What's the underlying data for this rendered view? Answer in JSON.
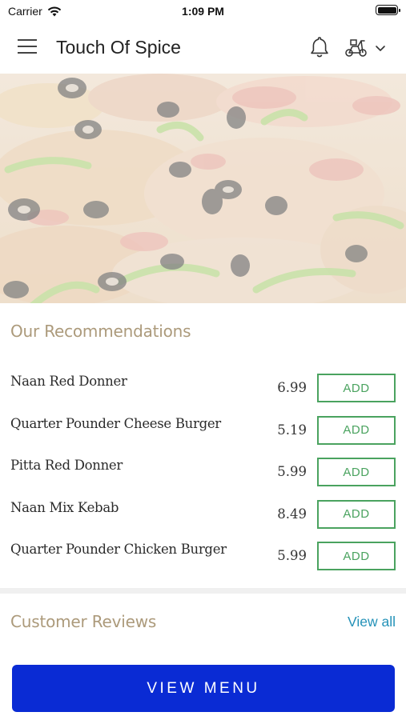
{
  "status_bar": {
    "carrier": "Carrier",
    "time": "1:09 PM"
  },
  "header": {
    "title": "Touch Of Spice",
    "menu_icon": "hamburger-menu-icon",
    "notification_icon": "bell-icon",
    "delivery_icon": "scooter-icon",
    "dropdown_icon": "chevron-down-icon"
  },
  "hero": {
    "image": "pizza-photo"
  },
  "recommendations": {
    "title": "Our Recommendations",
    "add_label": "ADD",
    "items": [
      {
        "name": "Naan Red Donner",
        "price": "6.99"
      },
      {
        "name": "Quarter Pounder Cheese Burger",
        "price": "5.19"
      },
      {
        "name": "Pitta Red Donner",
        "price": "5.99"
      },
      {
        "name": "Naan Mix Kebab",
        "price": "8.49"
      },
      {
        "name": "Quarter Pounder Chicken Burger",
        "price": "5.99"
      }
    ]
  },
  "reviews": {
    "title": "Customer Reviews",
    "view_all": "View all"
  },
  "cta": {
    "label": "VIEW MENU"
  },
  "colors": {
    "accent_title": "#ac9a7b",
    "add_button": "#4aa35f",
    "link": "#2492b8",
    "primary_button": "#0a2bd4"
  }
}
